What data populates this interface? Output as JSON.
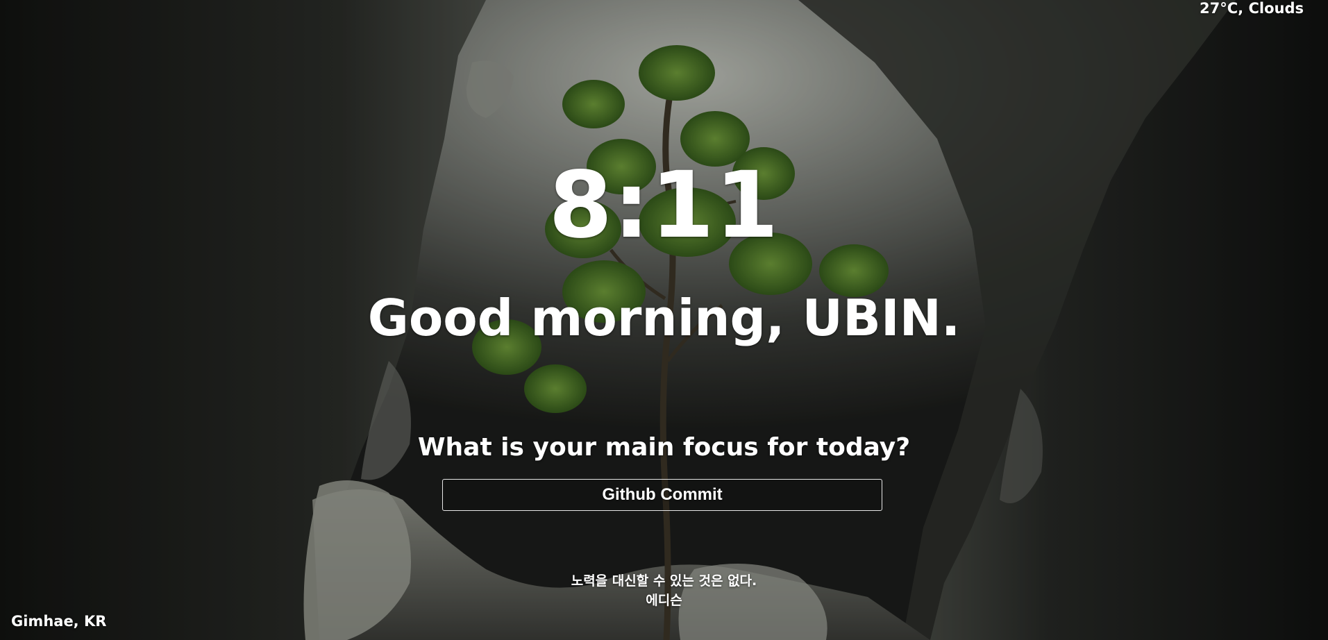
{
  "weather": {
    "text": "27°C, Clouds"
  },
  "clock": {
    "time": "8:11"
  },
  "greeting": {
    "text": "Good morning, UBIN."
  },
  "focus": {
    "question": "What is your main focus for today?",
    "value": "Github Commit"
  },
  "quote": {
    "text": "노력을 대신할 수 있는 것은 없다.",
    "author": "에디슨"
  },
  "location": {
    "text": "Gimhae, KR"
  },
  "background": {
    "description_icon": "cave-canyon-tree-photo-icon",
    "sky_color": "#b9bcb4",
    "tree_color": "#4f7a2a",
    "rock_dark": "#141614",
    "rock_mid": "#4a4d47"
  }
}
